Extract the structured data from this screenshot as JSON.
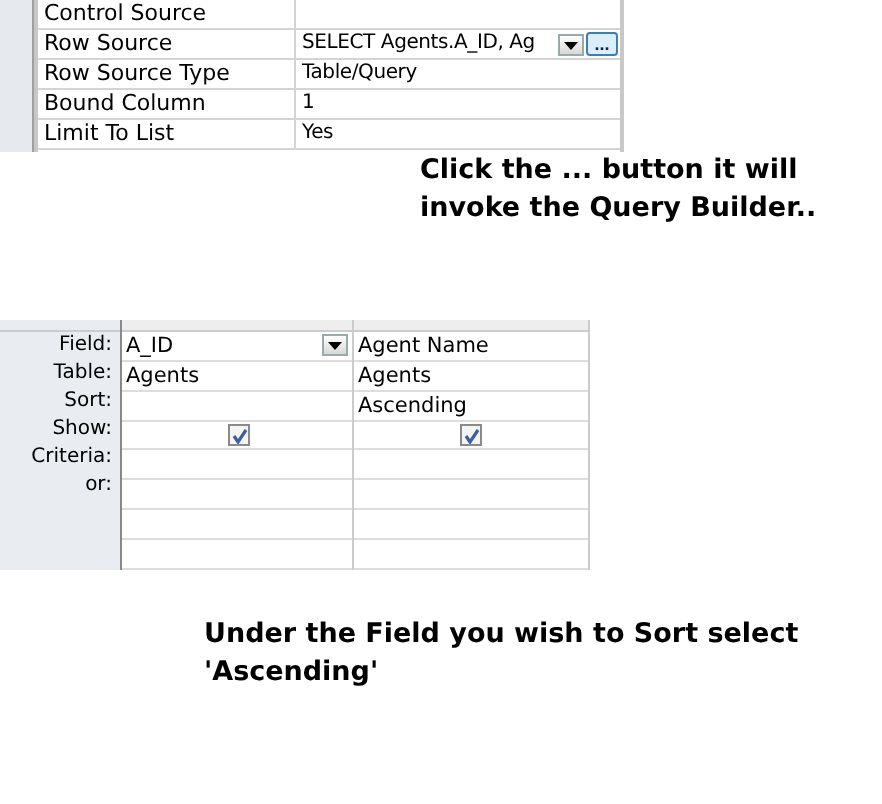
{
  "property_sheet": {
    "rows": [
      {
        "label": "Control Source",
        "value": ""
      },
      {
        "label": "Row Source",
        "value": "SELECT Agents.A_ID, Ag",
        "builder_button": "..."
      },
      {
        "label": "Row Source Type",
        "value": "Table/Query"
      },
      {
        "label": "Bound Column",
        "value": "1"
      },
      {
        "label": "Limit To List",
        "value": "Yes"
      }
    ]
  },
  "note_1": "Click the ... button it will invoke the Query Builder..",
  "query_grid": {
    "row_labels": [
      "Field:",
      "Table:",
      "Sort:",
      "Show:",
      "Criteria:",
      "or:"
    ],
    "columns": [
      {
        "field": "A_ID",
        "table": "Agents",
        "show": true,
        "active": true
      },
      {
        "field": "Agent Name",
        "table": "Agents",
        "sort": "Ascending",
        "show": true,
        "active": false
      }
    ]
  },
  "note_2": "Under the Field you wish to Sort select 'Ascending'"
}
